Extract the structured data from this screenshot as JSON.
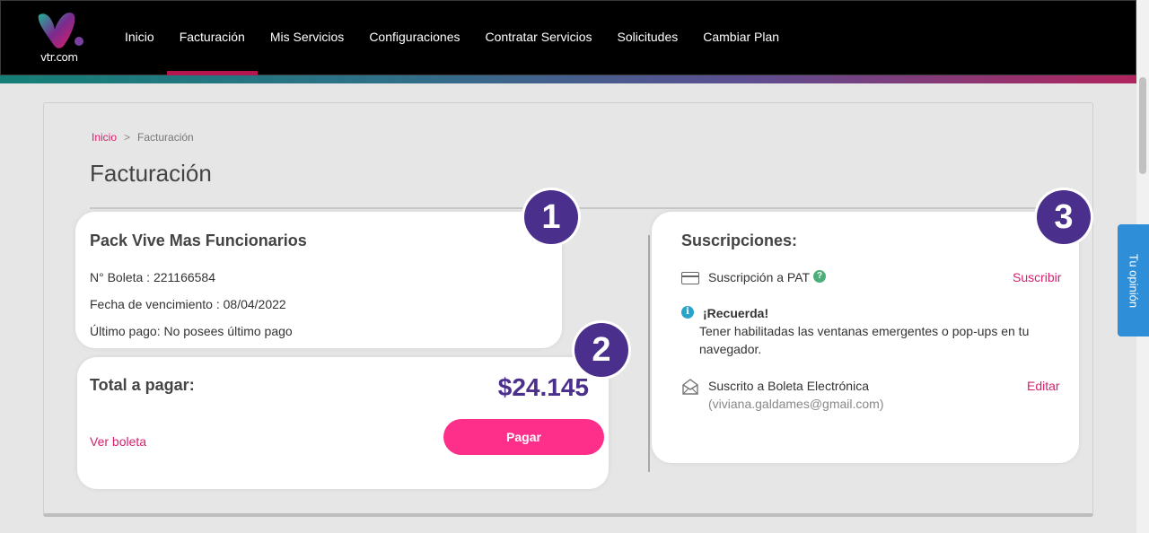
{
  "header": {
    "logo_text": "vtr.com",
    "nav": [
      {
        "label": "Inicio"
      },
      {
        "label": "Facturación"
      },
      {
        "label": "Mis Servicios"
      },
      {
        "label": "Configuraciones"
      },
      {
        "label": "Contratar Servicios"
      },
      {
        "label": "Solicitudes"
      },
      {
        "label": "Cambiar Plan"
      }
    ],
    "active_nav": "Facturación"
  },
  "feedback_tab": "Tu opinión",
  "breadcrumb": {
    "home": "Inicio",
    "separator": ">",
    "current": "Facturación"
  },
  "page_title": "Facturación",
  "bill_card": {
    "plan": "Pack Vive Mas Funcionarios",
    "boleta": "N° Boleta : 221166584",
    "due_date": "Fecha de vencimiento : 08/04/2022",
    "last_payment": "Último pago: No posees último pago"
  },
  "total_card": {
    "label": "Total a pagar:",
    "amount": "$24.145",
    "view_bill": "Ver boleta",
    "pay_button": "Pagar"
  },
  "subscriptions": {
    "title": "Suscripciones:",
    "pat_label": "Suscripción a PAT",
    "pat_action": "Suscribir",
    "reminder_title": "¡Recuerda!",
    "reminder_line1": "Tener habilitadas las ventanas emergentes o pop-ups en tu",
    "reminder_line2": "navegador.",
    "ebill_label": "Suscrito a Boleta Electrónica",
    "ebill_email": "(viviana.galdames@gmail.com)",
    "ebill_action": "Editar"
  },
  "step_badges": [
    "1",
    "2",
    "3"
  ],
  "colors": {
    "accent_pink": "#fd2f8b",
    "link_pink": "#d6206e",
    "badge_purple": "#4b2f8d",
    "nav_active_underline": "#b4174f",
    "feedback_blue": "#2e8fd8"
  }
}
